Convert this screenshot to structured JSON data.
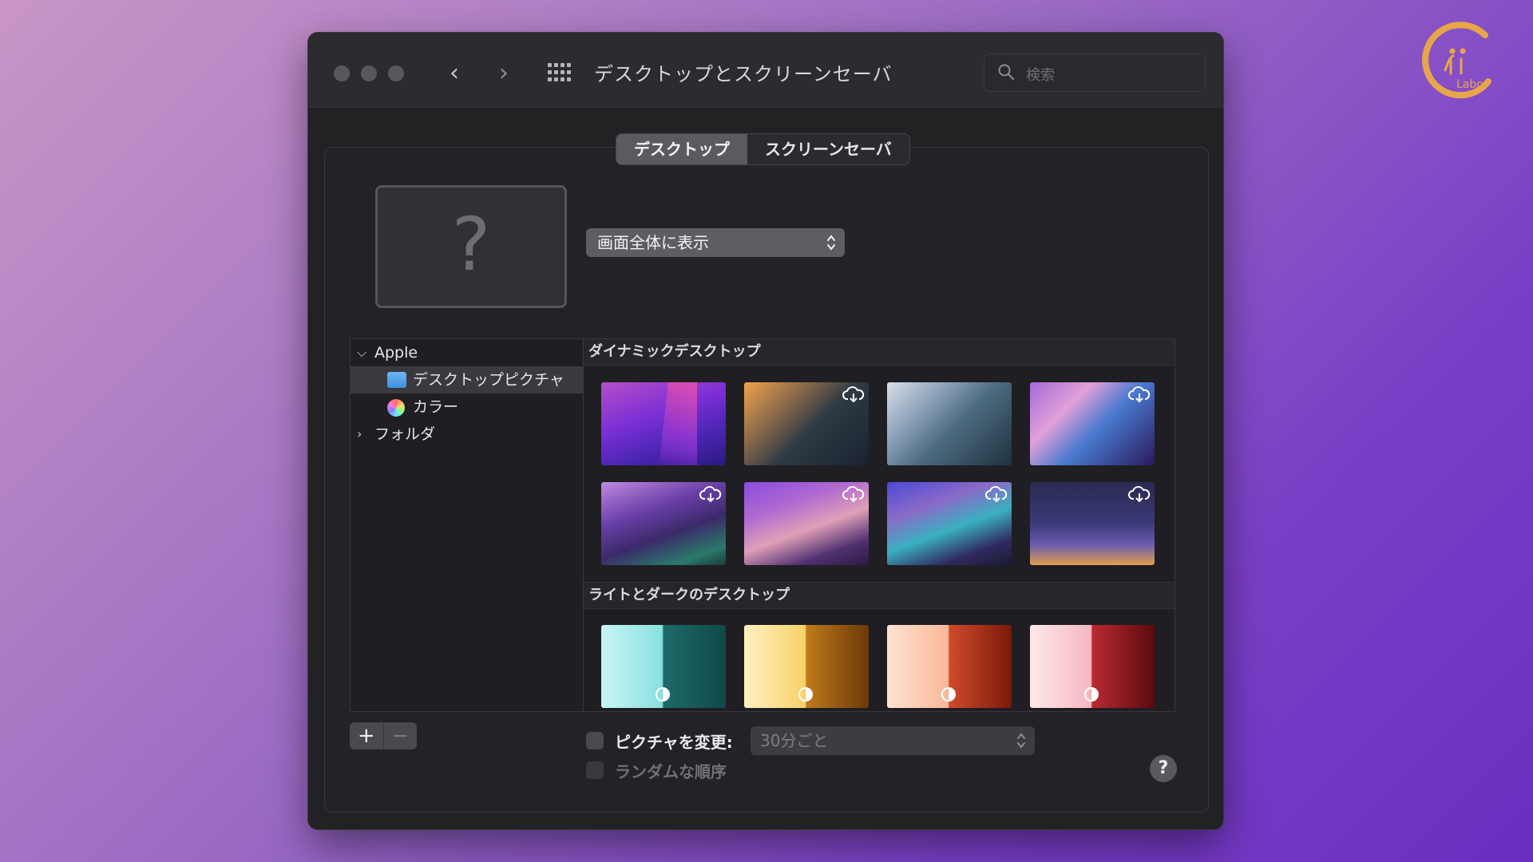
{
  "window": {
    "title": "デスクトップとスクリーンセーバ",
    "search_placeholder": "検索"
  },
  "tabs": [
    {
      "label": "デスクトップ",
      "active": true
    },
    {
      "label": "スクリーンセーバ",
      "active": false
    }
  ],
  "preview": {
    "placeholder_glyph": "?"
  },
  "fit_menu": {
    "selected": "画面全体に表示"
  },
  "sidebar": {
    "group_label": "Apple",
    "items": [
      {
        "label": "デスクトップピクチャ",
        "icon": "folder-icon",
        "selected": true
      },
      {
        "label": "カラー",
        "icon": "color-wheel-icon",
        "selected": false
      }
    ],
    "folder_label": "フォルダ"
  },
  "sections": {
    "dynamic_title": "ダイナミックデスクトップ",
    "light_dark_title": "ライトとダークのデスクトップ"
  },
  "wallpapers": {
    "dynamic": [
      {
        "name": "monterey",
        "download": false
      },
      {
        "name": "catalina-coast",
        "download": true
      },
      {
        "name": "catalina",
        "download": false
      },
      {
        "name": "big-sur-road",
        "download": true
      },
      {
        "name": "coast-1",
        "download": true
      },
      {
        "name": "coast-2",
        "download": true
      },
      {
        "name": "coast-3",
        "download": true
      },
      {
        "name": "gradient-blue",
        "download": true
      }
    ],
    "light_dark": [
      {
        "name": "teal",
        "icon": "light-dark-icon"
      },
      {
        "name": "yellow",
        "icon": "light-dark-icon"
      },
      {
        "name": "orange",
        "icon": "light-dark-icon"
      },
      {
        "name": "red",
        "icon": "light-dark-icon"
      }
    ]
  },
  "controls": {
    "add_label": "+",
    "remove_label": "−",
    "change_picture_label": "ピクチャを変更:",
    "change_picture_checked": false,
    "interval_selected": "30分ごと",
    "random_order_label": "ランダムな順序",
    "random_order_checked": false,
    "help_label": "?"
  },
  "colors": {
    "window_bg": "#222124",
    "accent_folder": "#3d8fe0",
    "selected_row": "#3a393e"
  }
}
